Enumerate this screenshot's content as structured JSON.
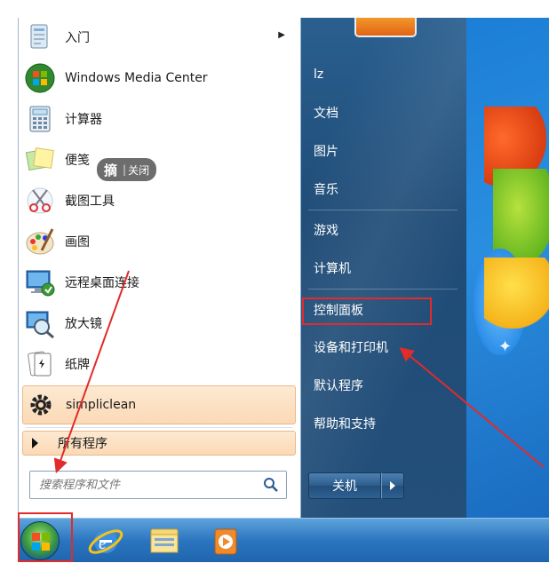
{
  "start_menu": {
    "programs": [
      {
        "label": "入门",
        "icon": "getting-started-icon",
        "has_submenu": true
      },
      {
        "label": "Windows Media Center",
        "icon": "media-center-icon"
      },
      {
        "label": "计算器",
        "icon": "calculator-icon"
      },
      {
        "label": "便笺",
        "icon": "sticky-notes-icon"
      },
      {
        "label": "截图工具",
        "icon": "snipping-tool-icon"
      },
      {
        "label": "画图",
        "icon": "paint-icon"
      },
      {
        "label": "远程桌面连接",
        "icon": "remote-desktop-icon"
      },
      {
        "label": "放大镜",
        "icon": "magnifier-icon"
      },
      {
        "label": "纸牌",
        "icon": "solitaire-icon"
      },
      {
        "label": "simpliclean",
        "icon": "gear-icon"
      }
    ],
    "all_programs_label": "所有程序",
    "search": {
      "placeholder": "搜索程序和文件"
    },
    "tooltip": {
      "big": "摘",
      "sep": "|",
      "action": "关闭"
    },
    "right_items": [
      {
        "label": "lz"
      },
      {
        "label": "文档"
      },
      {
        "label": "图片"
      },
      {
        "label": "音乐"
      },
      {
        "label": "游戏"
      },
      {
        "label": "计算机"
      },
      {
        "label": "控制面板"
      },
      {
        "label": "设备和打印机"
      },
      {
        "label": "默认程序"
      },
      {
        "label": "帮助和支持"
      }
    ],
    "shutdown_label": "关机"
  },
  "taskbar": {
    "items": [
      "start-orb",
      "internet-explorer-icon",
      "windows-explorer-icon",
      "media-player-icon"
    ]
  },
  "colors": {
    "annotation_red": "#e22b2b",
    "highlight_orange": "#fbd9b5",
    "right_pane_blue": "#234f7a"
  }
}
